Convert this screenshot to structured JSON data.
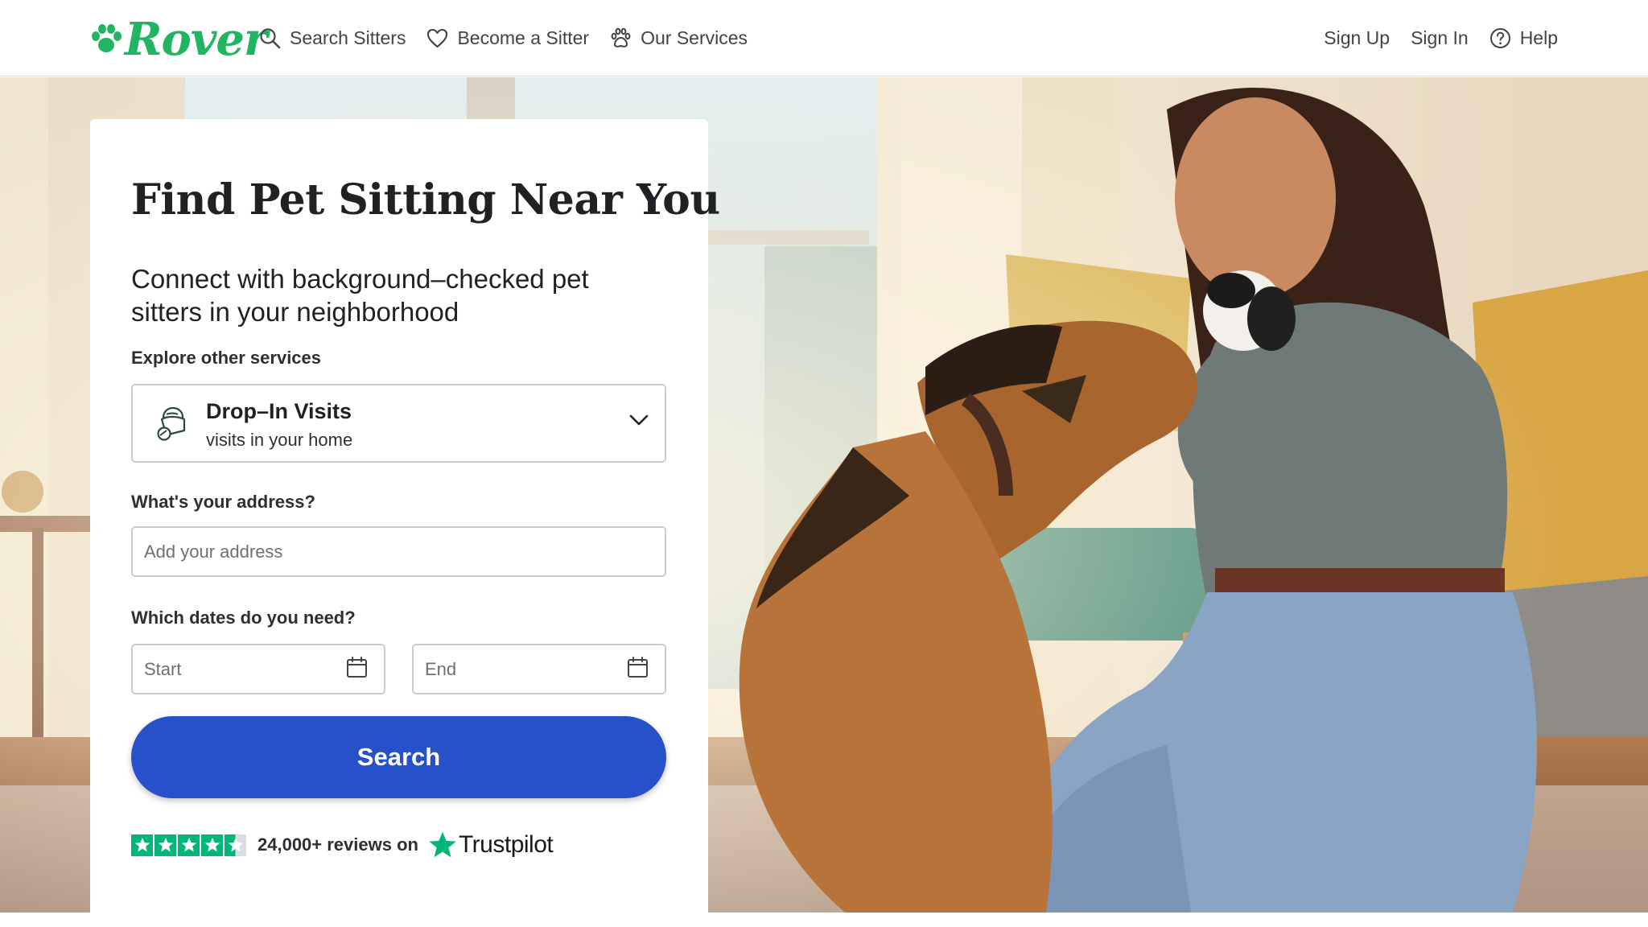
{
  "header": {
    "logo_text": "Rover",
    "nav_left": [
      {
        "label": "Search Sitters",
        "icon": "search-icon"
      },
      {
        "label": "Become a Sitter",
        "icon": "heart-icon"
      },
      {
        "label": "Our Services",
        "icon": "paw-icon"
      }
    ],
    "nav_right": {
      "sign_up": "Sign Up",
      "sign_in": "Sign In",
      "help": "Help",
      "help_icon": "question-circle-icon"
    }
  },
  "card": {
    "title": "Find Pet Sitting Near You",
    "subtitle": "Connect with background–checked pet sitters in your neighborhood",
    "services_label": "Explore other services",
    "service": {
      "name": "Drop–In Visits",
      "description": "visits in your home",
      "icon": "drop-in-visit-icon"
    },
    "address_label": "What's your address?",
    "address_placeholder": "Add your address",
    "dates_label": "Which dates do you need?",
    "start_placeholder": "Start",
    "end_placeholder": "End",
    "search_label": "Search",
    "trust": {
      "rating_stars": 4.5,
      "reviews_text": "24,000+ reviews on",
      "brand": "Trustpilot"
    }
  },
  "colors": {
    "brand_green": "#22b561",
    "search_button": "#2651c9",
    "trustpilot_green": "#00b67a"
  }
}
